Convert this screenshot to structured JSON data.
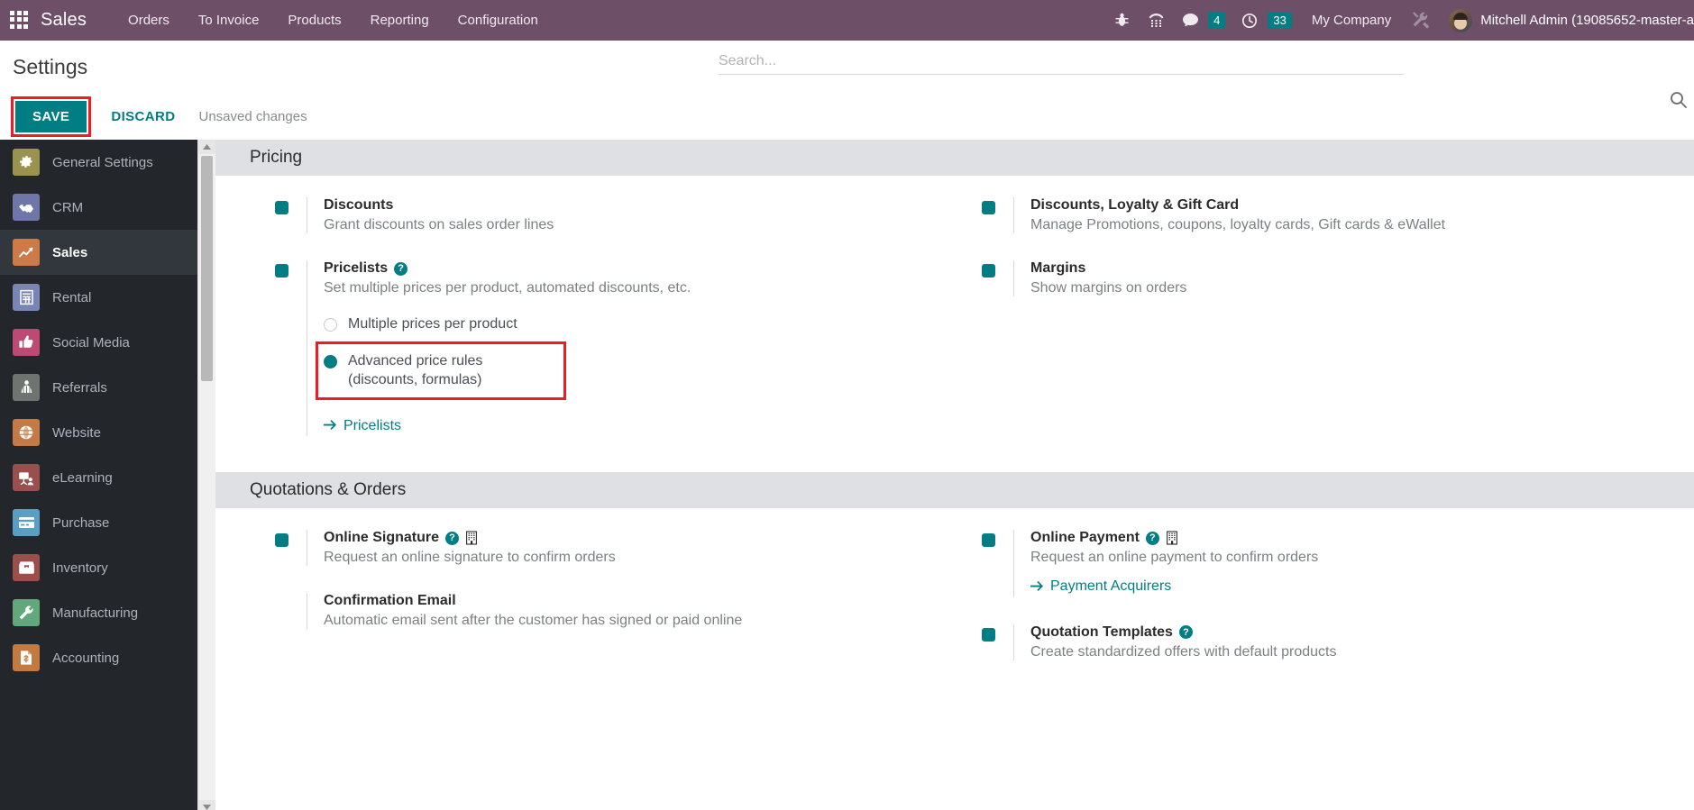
{
  "navbar": {
    "apps_icon": "apps-grid-icon",
    "brand": "Sales",
    "menus": [
      {
        "label": "Orders"
      },
      {
        "label": "To Invoice"
      },
      {
        "label": "Products"
      },
      {
        "label": "Reporting"
      },
      {
        "label": "Configuration"
      }
    ],
    "sys_icons": [
      {
        "name": "bug-icon"
      },
      {
        "name": "dialpad-icon"
      }
    ],
    "messages": {
      "icon": "chat-bubble-icon",
      "count": "4"
    },
    "activities": {
      "icon": "clock-icon",
      "count": "33"
    },
    "company": "My Company",
    "tools_icon": "tools-icon",
    "avatar": "user-avatar",
    "user": "Mitchell Admin (19085652-master-a",
    "accent": "#017e84",
    "bar_color": "#6d5068"
  },
  "control_panel": {
    "title": "Settings",
    "search_placeholder": "Search...",
    "search_value": "",
    "search_icon": "search-icon"
  },
  "savebar": {
    "save_label": "SAVE",
    "discard_label": "DISCARD",
    "status": "Unsaved changes",
    "highlight_color": "#ef1b25"
  },
  "sidebar": {
    "items": [
      {
        "label": "General Settings",
        "icon": "gear-icon",
        "color": "#9a9350",
        "active": false
      },
      {
        "label": "CRM",
        "icon": "handshake-icon",
        "color": "#6f76a8",
        "active": false
      },
      {
        "label": "Sales",
        "icon": "chart-line-icon",
        "color": "#cc7a48",
        "active": true
      },
      {
        "label": "Rental",
        "icon": "document-grid-icon",
        "color": "#7b85b5",
        "active": false
      },
      {
        "label": "Social Media",
        "icon": "thumbs-up-icon",
        "color": "#bd4a73",
        "active": false
      },
      {
        "label": "Referrals",
        "icon": "person-gift-icon",
        "color": "#6f7470",
        "active": false
      },
      {
        "label": "Website",
        "icon": "globe-icon",
        "color": "#c47a46",
        "active": false
      },
      {
        "label": "eLearning",
        "icon": "presentation-icon",
        "color": "#9a4f4f",
        "active": false
      },
      {
        "label": "Purchase",
        "icon": "credit-card-icon",
        "color": "#5b9ec4",
        "active": false
      },
      {
        "label": "Inventory",
        "icon": "box-icon",
        "color": "#9a4f4a",
        "active": false
      },
      {
        "label": "Manufacturing",
        "icon": "wrench-icon",
        "color": "#62a87c",
        "active": false
      },
      {
        "label": "Accounting",
        "icon": "invoice-dollar-icon",
        "color": "#c4793f",
        "active": false
      }
    ]
  },
  "sections": [
    {
      "title": "Pricing",
      "left": [
        {
          "checkbox": "on",
          "title": "Discounts",
          "desc": "Grant discounts on sales order lines",
          "help": false,
          "company": false
        },
        {
          "checkbox": "on",
          "title": "Pricelists",
          "desc": "Set multiple prices per product, automated discounts, etc.",
          "help": true,
          "company": false,
          "radios": [
            {
              "label": "Multiple prices per product",
              "selected": false,
              "highlighted": false
            },
            {
              "label": "Advanced price rules\n(discounts, formulas)",
              "selected": true,
              "highlighted": true
            }
          ],
          "link": {
            "label": "Pricelists",
            "icon": "arrow-right-icon"
          }
        }
      ],
      "right": [
        {
          "checkbox": "on",
          "title": "Discounts, Loyalty & Gift Card",
          "desc": "Manage Promotions, coupons, loyalty cards, Gift cards & eWallet",
          "help": false,
          "company": false
        },
        {
          "checkbox": "on",
          "title": "Margins",
          "desc": "Show margins on orders",
          "help": false,
          "company": false
        }
      ]
    },
    {
      "title": "Quotations & Orders",
      "left": [
        {
          "checkbox": "on",
          "title": "Online Signature",
          "desc": "Request an online signature to confirm orders",
          "help": true,
          "company": true
        },
        {
          "checkbox": "hidden",
          "title": "Confirmation Email",
          "desc": "Automatic email sent after the customer has signed or paid online",
          "help": false,
          "company": false
        }
      ],
      "right": [
        {
          "checkbox": "on",
          "title": "Online Payment",
          "desc": "Request an online payment to confirm orders",
          "help": true,
          "company": true,
          "link": {
            "label": "Payment Acquirers",
            "icon": "arrow-right-icon"
          }
        },
        {
          "checkbox": "on",
          "title": "Quotation Templates",
          "desc": "Create standardized offers with default products",
          "help": true,
          "company": false
        }
      ]
    }
  ]
}
